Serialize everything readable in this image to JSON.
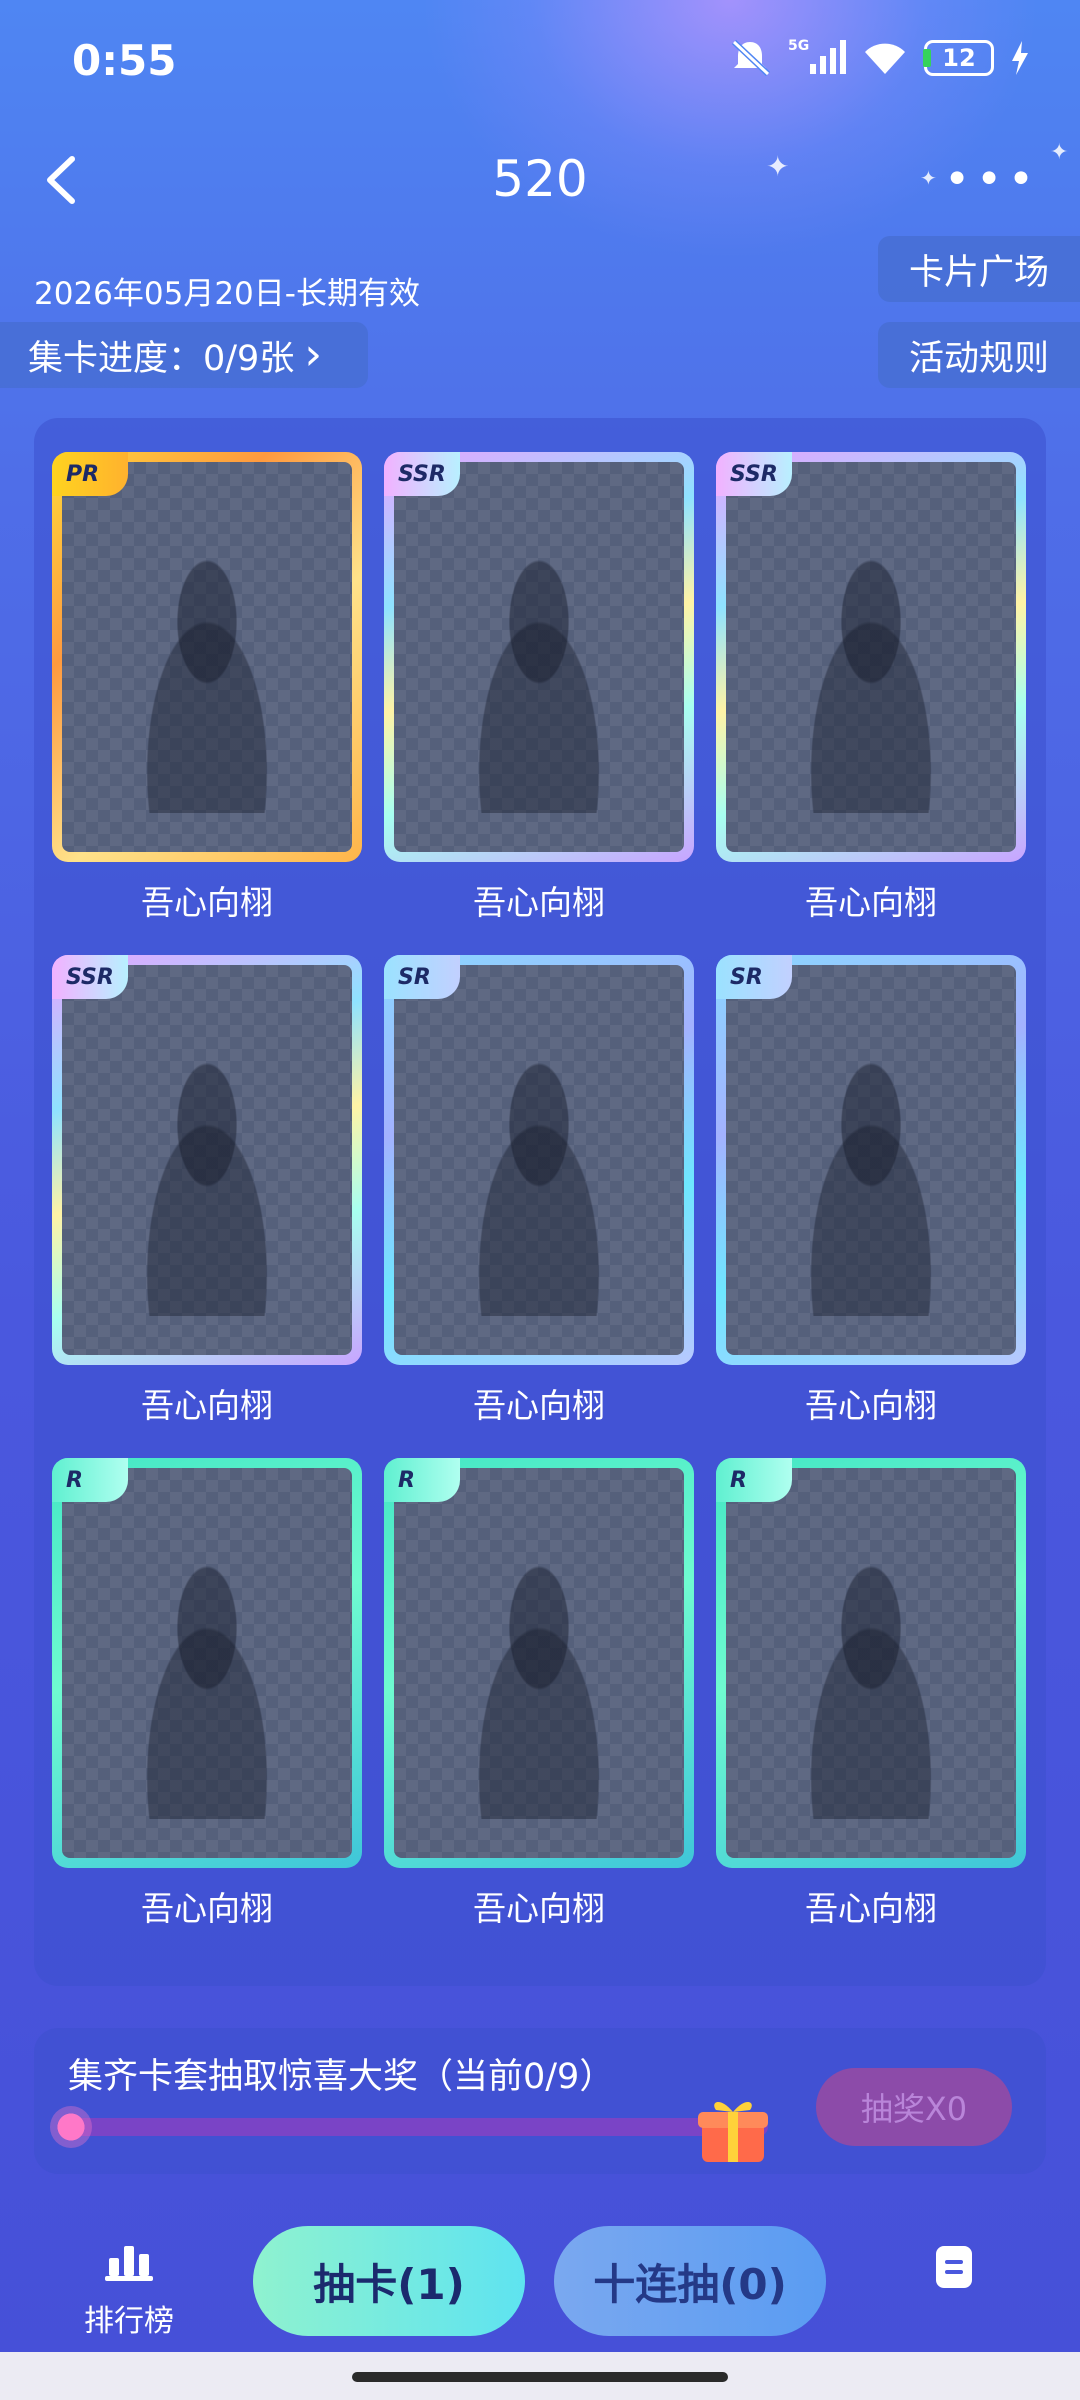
{
  "status_bar": {
    "time": "0:55",
    "network": "5G",
    "battery": "12"
  },
  "header": {
    "title": "520"
  },
  "validity": "2026年05月20日-长期有效",
  "progress": {
    "label": "集卡进度：0/9张",
    "chevron": "›"
  },
  "side_buttons": {
    "plaza": "卡片广场",
    "rules": "活动规则"
  },
  "cards": [
    {
      "rarity": "PR",
      "name": "吾心向栩"
    },
    {
      "rarity": "SSR",
      "name": "吾心向栩"
    },
    {
      "rarity": "SSR",
      "name": "吾心向栩"
    },
    {
      "rarity": "SSR",
      "name": "吾心向栩"
    },
    {
      "rarity": "SR",
      "name": "吾心向栩"
    },
    {
      "rarity": "SR",
      "name": "吾心向栩"
    },
    {
      "rarity": "R",
      "name": "吾心向栩"
    },
    {
      "rarity": "R",
      "name": "吾心向栩"
    },
    {
      "rarity": "R",
      "name": "吾心向栩"
    }
  ],
  "prize": {
    "text": "集齐卡套抽取惊喜大奖（当前0/9）",
    "progress_fraction": 0,
    "button": "抽奖X0"
  },
  "bottom": {
    "rank_label": "排行榜",
    "draw_label": "抽卡(1)",
    "ten_draw_label": "十连抽(0)"
  },
  "colors": {
    "accent_mint": "#8ff2cf",
    "accent_blue": "#5a9cf2",
    "prize_track": "#7a44c6"
  }
}
